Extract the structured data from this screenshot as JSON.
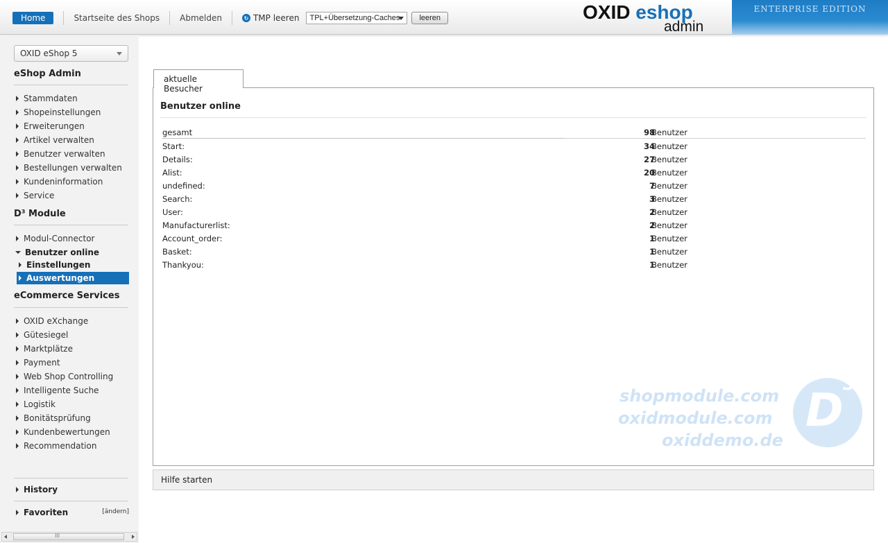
{
  "topbar": {
    "home_label": "Home",
    "shop_start_label": "Startseite des Shops",
    "logout_label": "Abmelden",
    "tmp_label": "TMP leeren",
    "cache_select_value": "TPL+Übersetzung-Caches",
    "clear_button_label": "leeren",
    "logo_part1": "OXID ",
    "logo_part2": "eshop",
    "logo_sub": "admin",
    "edition": "ENTERPRISE EDITION"
  },
  "sidebar": {
    "shop_select_value": "OXID eShop 5",
    "sections": {
      "eshop_admin": {
        "title": "eShop Admin",
        "items": [
          "Stammdaten",
          "Shopeinstellungen",
          "Erweiterungen",
          "Artikel verwalten",
          "Benutzer verwalten",
          "Bestellungen verwalten",
          "Kundeninformation",
          "Service"
        ]
      },
      "d3": {
        "title": "D³ Module",
        "items": [
          "Modul-Connector",
          "Benutzer online"
        ],
        "subitems": [
          "Einstellungen",
          "Auswertungen"
        ]
      },
      "ecommerce": {
        "title": "eCommerce Services",
        "items": [
          "OXID eXchange",
          "Gütesiegel",
          "Marktplätze",
          "Payment",
          "Web Shop Controlling",
          "Intelligente Suche",
          "Logistik",
          "Bonitätsprüfung",
          "Kundenbewertungen",
          "Recommendation"
        ]
      }
    },
    "history_label": "History",
    "favorites_label": "Favoriten",
    "favorites_edit": "[ändern]",
    "scroll_grip": "III"
  },
  "main": {
    "tab_label": "aktuelle Besucher",
    "title": "Benutzer online",
    "unit": "Benutzer",
    "total": {
      "name": "gesamt",
      "count": "98"
    },
    "rows": [
      {
        "name": "Start:",
        "count": "34"
      },
      {
        "name": "Details:",
        "count": "27"
      },
      {
        "name": "Alist:",
        "count": "20"
      },
      {
        "name": "undefined:",
        "count": "7"
      },
      {
        "name": "Search:",
        "count": "3"
      },
      {
        "name": "User:",
        "count": "2"
      },
      {
        "name": "Manufacturerlist:",
        "count": "2"
      },
      {
        "name": "Account_order:",
        "count": "1"
      },
      {
        "name": "Basket:",
        "count": "1"
      },
      {
        "name": "Thankyou:",
        "count": "1"
      }
    ],
    "watermark": {
      "line1": "shopmodule.com",
      "line2": "oxidmodule.com",
      "line3": "oxiddemo.de",
      "logo_letter": "D",
      "logo_sup": "3"
    },
    "help_label": "Hilfe starten"
  },
  "colors": {
    "accent": "#1670b8",
    "sidebar_bg": "#f2f2f2",
    "watermark": "#cfe3f6"
  }
}
